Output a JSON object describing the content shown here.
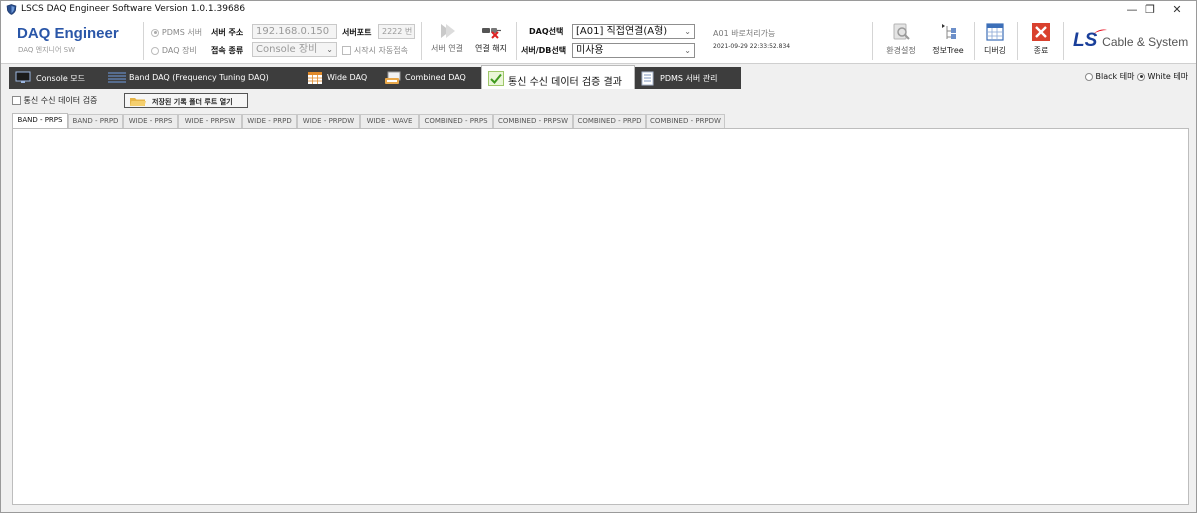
{
  "window": {
    "title": "LSCS DAQ Engineer Software Version 1.0.1.39686",
    "controls": {
      "minimize": "—",
      "restore": "❐",
      "close": "✕"
    }
  },
  "header": {
    "app_name": "DAQ Engineer",
    "app_subtitle": "DAQ 엔지니어 SW",
    "source": {
      "pdms_label": "PDMS 서버",
      "daq_label": "DAQ 장비",
      "selected": "PDMS 서버"
    },
    "server_address_label": "서버 주소",
    "server_address_value": "192.168.0.150",
    "server_port_label": "서버포트",
    "server_port_value": "2222 번",
    "connect_type_label": "접속 종류",
    "connect_type_value": "Console 장비",
    "auto_connect_label": "시작시 자동접속",
    "auto_connect_checked": false,
    "connect_button": "서버 연결",
    "disconnect_button": "연결 해지",
    "daq_select_label": "DAQ선택",
    "daq_select_value": "[A01] 직접연결(A형)",
    "db_select_label": "서버/DB선택",
    "db_select_value": "미사용",
    "status_text": "A01 바로처리가능",
    "status_timestamp": "2021-09-29 22:33:52.834",
    "settings_button": "환경설정",
    "info_tree_button": "정보Tree",
    "debug_button": "디버깅",
    "exit_button": "종료",
    "brand_ls": "LS",
    "brand_text": "Cable & System"
  },
  "main_tabs": [
    {
      "label": "Console 모드",
      "icon": "monitor-icon"
    },
    {
      "label": "Band DAQ (Frequency Tuning DAQ)",
      "icon": "band-chart-icon"
    },
    {
      "label": "Wide DAQ",
      "icon": "grid-icon"
    },
    {
      "label": "Combined DAQ",
      "icon": "combined-icon"
    },
    {
      "label": "통신 수신 데이터 검증 결과",
      "icon": "check-icon",
      "active": true
    },
    {
      "label": "PDMS 서버 관리",
      "icon": "document-icon"
    }
  ],
  "theme": {
    "black_label": "Black 테마",
    "white_label": "White 테마",
    "selected": "White 테마"
  },
  "content": {
    "verify_checkbox_label": "통신 수신 데이터 검증",
    "verify_checked": false,
    "open_folder_button": "저장된 기록 폴더 루트 열기"
  },
  "sub_tabs": [
    "BAND - PRPS",
    "BAND - PRPD",
    "WIDE - PRPS",
    "WIDE - PRPSW",
    "WIDE - PRPD",
    "WIDE - PRPDW",
    "WIDE - WAVE",
    "COMBINED - PRPS",
    "COMBINED - PRPSW",
    "COMBINED - PRPD",
    "COMBINED - PRPDW"
  ],
  "active_sub_tab": "BAND - PRPS",
  "colors": {
    "accent_blue": "#2a56a8",
    "tab_dark": "#3d3d3d",
    "exit_red": "#d9412e",
    "brand_red": "#e60012"
  }
}
